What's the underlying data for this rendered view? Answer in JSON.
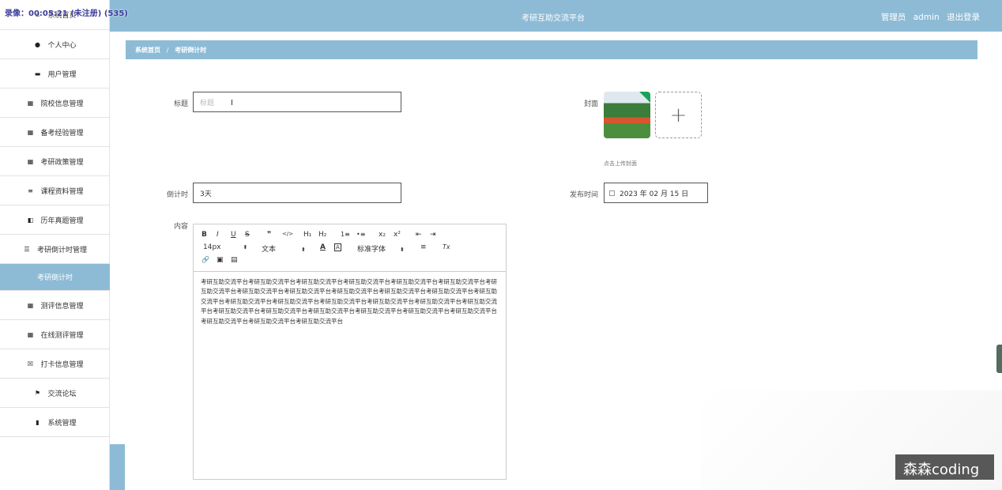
{
  "overlay": {
    "recording_text": "录像：00:05:21 (未注册) (535)"
  },
  "header": {
    "app_title": "考研互助交流平台",
    "user_role": "管理员",
    "username": "admin",
    "logout": "退出登录"
  },
  "sidebar": {
    "items": [
      {
        "label": "系统首页",
        "icon": "home-icon"
      },
      {
        "label": "个人中心",
        "icon": "person-icon"
      },
      {
        "label": "用户管理",
        "icon": "user-group-icon"
      },
      {
        "label": "院校信息管理",
        "icon": "grid-icon"
      },
      {
        "label": "备考经验管理",
        "icon": "grid-icon"
      },
      {
        "label": "考研政策管理",
        "icon": "grid-icon"
      },
      {
        "label": "课程资料管理",
        "icon": "list-icon"
      },
      {
        "label": "历年真题管理",
        "icon": "book-icon"
      },
      {
        "label": "考研倒计时管理",
        "icon": "list-icon"
      },
      {
        "label": "考研倒计时",
        "icon": ""
      },
      {
        "label": "测评信息管理",
        "icon": "grid-icon"
      },
      {
        "label": "在线测评管理",
        "icon": "grid-icon"
      },
      {
        "label": "打卡信息管理",
        "icon": "checkin-icon"
      },
      {
        "label": "交流论坛",
        "icon": "flag-icon"
      },
      {
        "label": "系统管理",
        "icon": "system-icon"
      }
    ]
  },
  "breadcrumb": {
    "home": "系统首页",
    "separator": "/",
    "current": "考研倒计时"
  },
  "form": {
    "title_label": "标题",
    "title_placeholder": "标题",
    "cover_label": "封面",
    "cover_tip": "点击上传封面",
    "countdown_label": "倒计时",
    "countdown_value": "3天",
    "publish_label": "发布时间",
    "publish_value": "2023 年 02 月 15 日",
    "content_label": "内容"
  },
  "editor": {
    "toolbar": {
      "bold": "B",
      "italic": "I",
      "underline": "U",
      "strike": "S",
      "quote": "❞",
      "code": "</>",
      "h1": "H₁",
      "h2": "H₂",
      "ordered": "1≡",
      "bullet": "•≡",
      "sub": "x₂",
      "sup": "x²",
      "indent_out": "⇤",
      "indent_in": "⇥",
      "size": "14px",
      "type": "文本",
      "font_color": "A",
      "bg_color": "A",
      "font": "标准字体",
      "align": "≡",
      "clear": "Tx",
      "link": "🔗",
      "image": "▣",
      "video": "▤"
    },
    "content": "考研互助交流平台考研互助交流平台考研互助交流平台考研互助交流平台考研互助交流平台考研互助交流平台考研互助交流平台考研互助交流平台考研互助交流平台考研互助交流平台考研互助交流平台考研互助交流平台考研互助交流平台考研互助交流平台考研互助交流平台考研互助交流平台考研互助交流平台考研互助交流平台考研互助交流平台考研互助交流平台考研互助交流平台考研互助交流平台考研互助交流平台考研互助交流平台考研互助交流平台考研互助交流平台考研互助交流平台考研互助交流平台"
  },
  "watermark": "森森coding"
}
